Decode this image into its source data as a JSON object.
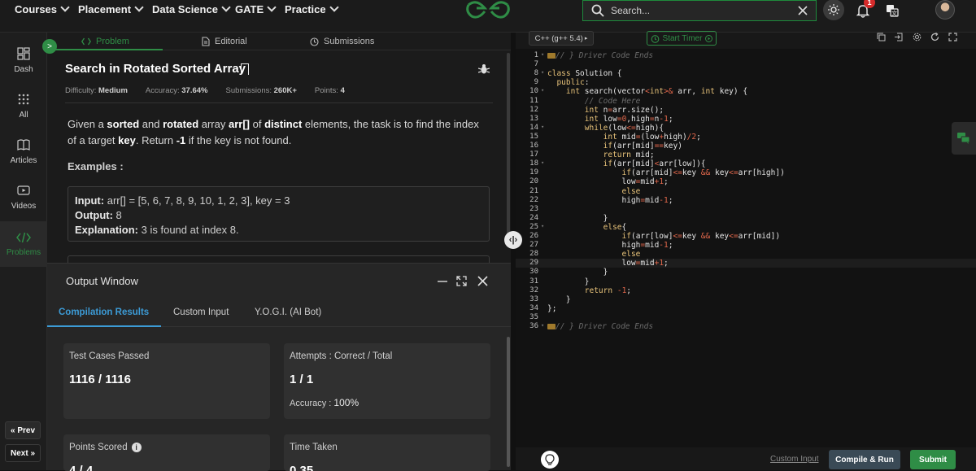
{
  "nav": {
    "items": [
      "Courses",
      "Placement",
      "Data Science",
      "GATE",
      "Practice"
    ],
    "search_placeholder": "Search...",
    "notification_count": "1"
  },
  "sidebar": {
    "items": [
      {
        "label": "Dash",
        "icon": "dashboard-icon"
      },
      {
        "label": "All",
        "icon": "grid-icon"
      },
      {
        "label": "Articles",
        "icon": "book-icon"
      },
      {
        "label": "Videos",
        "icon": "video-icon"
      },
      {
        "label": "Problems",
        "icon": "code-icon",
        "active": true
      }
    ],
    "prev_label": "Prev",
    "next_label": "Next"
  },
  "problem": {
    "tabs": [
      "Problem",
      "Editorial",
      "Submissions"
    ],
    "title": "Search in Rotated Sorted Array",
    "meta": {
      "difficulty_label": "Difficulty:",
      "difficulty": "Medium",
      "accuracy_label": "Accuracy:",
      "accuracy": "37.64%",
      "submissions_label": "Submissions:",
      "submissions": "260K+",
      "points_label": "Points:",
      "points": "4"
    },
    "description": {
      "p1": "Given a ",
      "w_sorted": "sorted",
      "p2": " and ",
      "w_rotated": "rotated",
      "p3": " array ",
      "w_arr": "arr[]",
      "p4": " of ",
      "w_distinct": "distinct",
      "p5": " elements, the task is to find the index of a target ",
      "w_key": "key",
      "p6": ". Return ",
      "w_neg": "-1",
      "p7": " if the key is not found."
    },
    "examples_title": "Examples :",
    "example1": {
      "input_label": "Input:",
      "input": "arr[] = [5, 6, 7, 8, 9, 10, 1, 2, 3], key = 3",
      "output_label": "Output:",
      "output": "8",
      "explanation_label": "Explanation:",
      "explanation": "3 is found at index 8."
    }
  },
  "output": {
    "title": "Output Window",
    "tabs": [
      "Compilation Results",
      "Custom Input",
      "Y.O.G.I. (AI Bot)"
    ],
    "cards": {
      "test_cases_label": "Test Cases Passed",
      "test_cases_value": "1116 / 1116",
      "attempts_label": "Attempts : Correct / Total",
      "attempts_value": "1 / 1",
      "accuracy_label": "Accuracy :",
      "accuracy_value": "100%",
      "points_label": "Points Scored",
      "points_value": "4 / 4",
      "time_label": "Time Taken",
      "time_value": "0.35"
    }
  },
  "editor": {
    "language": "C++ (g++ 5.4)",
    "timer_label": "Start Timer",
    "custom_input_label": "Custom Input",
    "compile_label": "Compile & Run",
    "submit_label": "Submit",
    "lines": [
      {
        "n": "1",
        "fold": true,
        "html": "<span class=\"fold-mark\"></span><span class=\"c\">// } Driver Code Ends</span>"
      },
      {
        "n": "7",
        "html": ""
      },
      {
        "n": "8",
        "fold": true,
        "html": "<span class=\"k\">class</span> Solution {"
      },
      {
        "n": "9",
        "html": "  <span class=\"k\">public</span>:"
      },
      {
        "n": "10",
        "fold": true,
        "html": "    <span class=\"t\">int</span> search(vector<span class=\"o\">&lt;</span><span class=\"t\">int</span><span class=\"o\">&gt;&amp;</span> arr, <span class=\"t\">int</span> key) {"
      },
      {
        "n": "11",
        "html": "        <span class=\"c\">// Code Here</span>"
      },
      {
        "n": "12",
        "html": "        <span class=\"t\">int</span> n<span class=\"o\">=</span>arr.size();"
      },
      {
        "n": "13",
        "html": "        <span class=\"t\">int</span> low<span class=\"o\">=</span><span class=\"n\">0</span>,high<span class=\"o\">=</span>n<span class=\"o\">-</span><span class=\"n\">1</span>;"
      },
      {
        "n": "14",
        "fold": true,
        "html": "        <span class=\"k\">while</span>(low<span class=\"o\">&lt;=</span>high){"
      },
      {
        "n": "15",
        "html": "            <span class=\"t\">int</span> mid<span class=\"o\">=</span>(low<span class=\"o\">+</span>high)<span class=\"o\">/</span><span class=\"n\">2</span>;"
      },
      {
        "n": "16",
        "html": "            <span class=\"k\">if</span>(arr[mid]<span class=\"o\">==</span>key)"
      },
      {
        "n": "17",
        "html": "            <span class=\"k\">return</span> mid;"
      },
      {
        "n": "18",
        "fold": true,
        "html": "            <span class=\"k\">if</span>(arr[mid]<span class=\"o\">&lt;</span>arr[low]){"
      },
      {
        "n": "19",
        "html": "                <span class=\"k\">if</span>(arr[mid]<span class=\"o\">&lt;=</span>key <span class=\"o\">&amp;&amp;</span> key<span class=\"o\">&lt;=</span>arr[high])"
      },
      {
        "n": "20",
        "html": "                low<span class=\"o\">=</span>mid<span class=\"o\">+</span><span class=\"n\">1</span>;"
      },
      {
        "n": "21",
        "html": "                <span class=\"k\">else</span>"
      },
      {
        "n": "22",
        "html": "                high<span class=\"o\">=</span>mid<span class=\"o\">-</span><span class=\"n\">1</span>;"
      },
      {
        "n": "23",
        "html": ""
      },
      {
        "n": "24",
        "html": "            }"
      },
      {
        "n": "25",
        "fold": true,
        "html": "            <span class=\"k\">else</span>{"
      },
      {
        "n": "26",
        "html": "                <span class=\"k\">if</span>(arr[low]<span class=\"o\">&lt;=</span>key <span class=\"o\">&amp;&amp;</span> key<span class=\"o\">&lt;=</span>arr[mid])"
      },
      {
        "n": "27",
        "html": "                high<span class=\"o\">=</span>mid<span class=\"o\">-</span><span class=\"n\">1</span>;"
      },
      {
        "n": "28",
        "html": "                <span class=\"k\">else</span>"
      },
      {
        "n": "29",
        "hl": true,
        "html": "                low<span class=\"o\">=</span>mid<span class=\"o\">+</span><span class=\"n\">1</span>;"
      },
      {
        "n": "30",
        "html": "            }"
      },
      {
        "n": "31",
        "html": "        }"
      },
      {
        "n": "32",
        "html": "        <span class=\"k\">return</span> <span class=\"o\">-</span><span class=\"n\">1</span>;"
      },
      {
        "n": "33",
        "html": "    }"
      },
      {
        "n": "34",
        "html": "};"
      },
      {
        "n": "35",
        "html": ""
      },
      {
        "n": "36",
        "fold": true,
        "html": "<span class=\"fold-mark\"></span><span class=\"c\">// } Driver Code Ends</span>"
      }
    ]
  },
  "colors": {
    "accent": "#2f8d46",
    "tab_blue": "#3c9bd6",
    "badge": "#d62b2b"
  }
}
